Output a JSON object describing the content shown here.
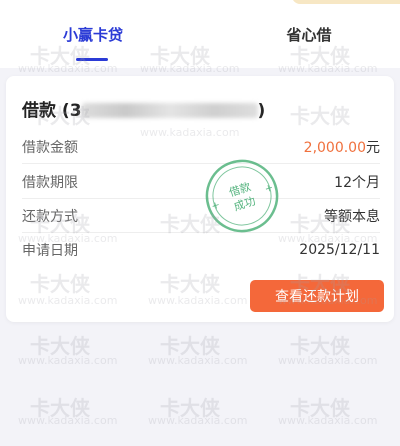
{
  "tabs": [
    {
      "label": "小赢卡贷",
      "active": true
    },
    {
      "label": "省心借",
      "active": false
    }
  ],
  "loan_card": {
    "title_prefix": "借款 (3",
    "title_suffix": ")",
    "rows": [
      {
        "label": "借款金额",
        "value_number": "2,000.00",
        "value_unit": "元"
      },
      {
        "label": "借款期限",
        "value": "12个月"
      },
      {
        "label": "还款方式",
        "value": "等额本息"
      },
      {
        "label": "申请日期",
        "value": "2025/12/11"
      }
    ],
    "stamp_line1": "借款",
    "stamp_line2": "成功",
    "plan_button": "查看还款计划"
  },
  "watermark": {
    "brand": "卡大侠",
    "url": "www.kadaxia.com"
  },
  "colors": {
    "accent": "#2b3bd6",
    "amount": "#f0713e",
    "button": "#f4683a",
    "stamp": "#3aa86a"
  }
}
